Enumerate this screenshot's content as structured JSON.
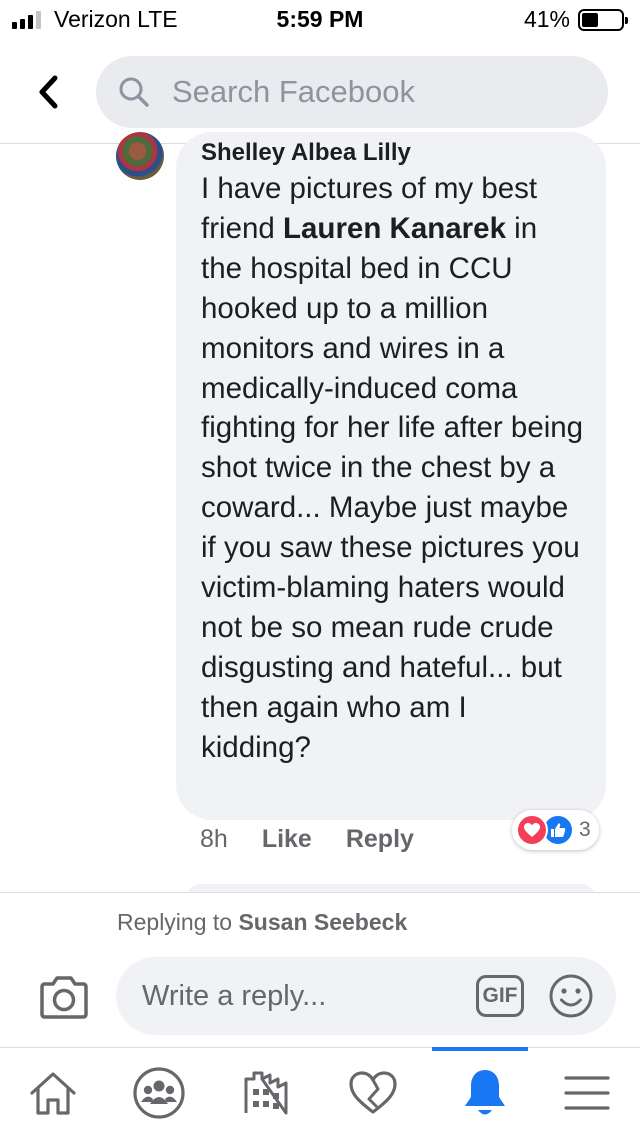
{
  "status_bar": {
    "carrier": "Verizon  LTE",
    "time": "5:59 PM",
    "battery_percent": "41%",
    "battery_level": 0.41,
    "signal_bars": 3,
    "signal_total": 4
  },
  "header": {
    "back_icon": "chevron-left-icon",
    "search_icon": "search-icon",
    "search_placeholder": "Search Facebook"
  },
  "comment": {
    "author": "Shelley Albea Lilly",
    "text_before": "I have pictures of my best friend ",
    "mention": "Lauren Kanarek",
    "text_after": " in the hospital bed in CCU hooked up to a million monitors and wires in a medically-induced coma fighting for her life after being shot twice in the chest by a coward... Maybe just maybe if you saw these pictures you victim-blaming haters would not be so mean rude crude disgusting and hateful... but then again who am I kidding?",
    "time": "8h",
    "like_label": "Like",
    "reply_label": "Reply",
    "reactions": [
      "love",
      "like"
    ],
    "reaction_count": "3"
  },
  "composer": {
    "replying_prefix": "Replying to ",
    "replying_to": "Susan Seebeck",
    "placeholder": "Write a reply...",
    "gif_label": "GIF",
    "camera_icon": "camera-icon",
    "emoji_icon": "emoji-icon"
  },
  "tab_bar": {
    "tabs": [
      {
        "icon": "home-icon",
        "active": false
      },
      {
        "icon": "groups-icon",
        "active": false
      },
      {
        "icon": "marketplace-icon",
        "active": false
      },
      {
        "icon": "dating-heart-icon",
        "active": false
      },
      {
        "icon": "notifications-bell-icon",
        "active": true
      },
      {
        "icon": "menu-icon",
        "active": false
      }
    ]
  },
  "colors": {
    "accent": "#1877f2",
    "love": "#f33e58",
    "bubble": "#f0f2f5",
    "secondary_text": "#65676b"
  }
}
